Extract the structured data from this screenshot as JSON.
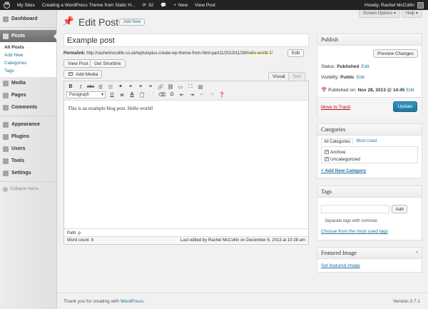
{
  "admin_bar": {
    "my_sites": "My Sites",
    "site_title": "Creating a WordPress Theme from Static H...",
    "updates_count": "32",
    "new_label": "New",
    "view_post": "View Post",
    "greeting": "Howdy, Rachel McCollin"
  },
  "sidebar": {
    "dashboard": "Dashboard",
    "posts": "Posts",
    "submenu": [
      "All Posts",
      "Add New",
      "Categories",
      "Tags"
    ],
    "media": "Media",
    "pages": "Pages",
    "comments": "Comments",
    "appearance": "Appearance",
    "plugins": "Plugins",
    "users": "Users",
    "tools": "Tools",
    "settings": "Settings",
    "collapse": "Collapse menu"
  },
  "screen_options": "Screen Options ▾",
  "help": "Help ▾",
  "page": {
    "title": "Edit Post",
    "add_new": "Add New",
    "post_title": "Example post",
    "permalink_label": "Permalink:",
    "permalink_base": "http://rachelmccollin.co.uk/wptutsplus-create-wp-theme-from-html-part11/2013/11/28/",
    "permalink_slug": "hello-world-2/",
    "edit_btn": "Edit",
    "view_post_btn": "View Post",
    "get_shortlink_btn": "Get Shortlink",
    "add_media_btn": "Add Media",
    "tab_visual": "Visual",
    "tab_text": "Text",
    "format_select": "Paragraph",
    "content": "This is an example blog post. Hello world!",
    "path": "Path: p",
    "word_count": "Word count: 8",
    "last_edited": "Last edited by Rachel McCollin on December 6, 2013 at 10:28 am"
  },
  "publish": {
    "title": "Publish",
    "preview": "Preview Changes",
    "status_label": "Status:",
    "status_value": "Published",
    "visibility_label": "Visibility:",
    "visibility_value": "Public",
    "published_on_label": "Published on:",
    "published_on_value": "Nov 28, 2013 @ 14:45",
    "edit": "Edit",
    "trash": "Move to Trash",
    "update": "Update"
  },
  "categories": {
    "title": "Categories",
    "tab_all": "All Categories",
    "tab_most_used": "Most Used",
    "items": [
      "Archive",
      "Uncategorized"
    ],
    "add_new": "+ Add New Category"
  },
  "tags": {
    "title": "Tags",
    "add_btn": "Add",
    "hint": "Separate tags with commas",
    "choose": "Choose from the most used tags"
  },
  "featured": {
    "title": "Featured Image",
    "link": "Set featured image"
  },
  "footer": {
    "thanks_prefix": "Thank you for creating with ",
    "thanks_link": "WordPress",
    "version": "Version 3.7.1"
  },
  "colors": {
    "admin_bar": "#222222",
    "link": "#21759b",
    "primary_button": "#21759b",
    "trash": "#bc0b0b"
  }
}
